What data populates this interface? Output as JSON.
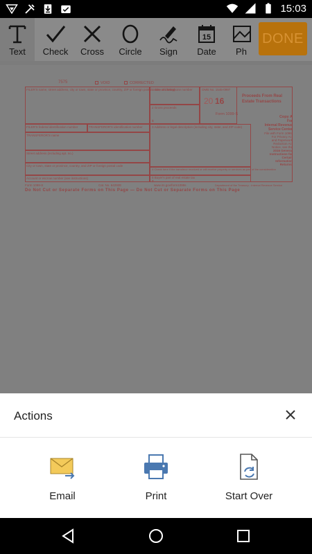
{
  "status_bar": {
    "time": "15:03",
    "icons": [
      "signal-outline-icon",
      "tools-icon",
      "download-icon",
      "image-check-icon",
      "wifi-icon",
      "cell-signal-icon",
      "battery-icon"
    ]
  },
  "toolbar": {
    "tools": [
      {
        "label": "Text",
        "icon": "text-T-icon",
        "active": true
      },
      {
        "label": "Check",
        "icon": "checkmark-icon"
      },
      {
        "label": "Cross",
        "icon": "cross-x-icon"
      },
      {
        "label": "Circle",
        "icon": "circle-icon"
      },
      {
        "label": "Sign",
        "icon": "pen-sign-icon"
      },
      {
        "label": "Date",
        "icon": "calendar-icon",
        "calendar_day": "15"
      },
      {
        "label": "Ph",
        "icon": "photo-icon"
      }
    ],
    "done_label": "DONE"
  },
  "document": {
    "form_code": "7575",
    "void_label": "VOID",
    "corrected_label": "CORRECTED",
    "filer_name_label": "FILER'S name, street address, city or town, state or province, country, ZIP or foreign postal code, and telephone number",
    "date_closing_label": "1 Date of closing",
    "omb_label": "OMB No. 1545-0997",
    "year_prefix": "20",
    "year_suffix": "16",
    "form_name": "Form 1099-S",
    "title_line1": "Proceeds From Real",
    "title_line2": "Estate Transactions",
    "gross_proceeds_label": "2 Gross proceeds",
    "dollar_sign": "$",
    "filer_tin_label": "FILER'S federal identification number",
    "transferor_tin_label": "TRANSFEROR'S identification number",
    "address_label": "3 Address or legal description (including city, state, and ZIP code)",
    "transferor_name_label": "TRANSFEROR'S name",
    "street_label": "Street address (including apt. no.)",
    "city_label": "City or town, state or province, country, and ZIP or foreign postal code",
    "account_label": "Account or escrow number (see instructions)",
    "check_here_label": "4 Check here if the transferor received or will receive property or services as part of the consideration",
    "buyer_tax_label": "5 Buyer's part of real estate tax",
    "copy_a_lines": [
      "Copy A",
      "For",
      "Internal Revenue",
      "Service Center",
      "File with Form 1096.",
      "For Privacy Act",
      "and Paperwork",
      "Reduction Act",
      "Notice, see the",
      "2016 General",
      "Instructions for",
      "Certain",
      "Information",
      "Returns."
    ],
    "footer_form": "Form 1099-S",
    "footer_cat": "Cat. No. 64292E",
    "footer_url": "www.irs.gov/form1099s",
    "footer_dept": "Department of the Treasury - Internal Revenue Service",
    "do_not_cut": "Do Not Cut or Separate Forms on This Page — Do Not Cut or Separate Forms on This Page"
  },
  "actions_sheet": {
    "title": "Actions",
    "items": [
      {
        "label": "Email",
        "icon": "email-send-icon"
      },
      {
        "label": "Print",
        "icon": "printer-icon"
      },
      {
        "label": "Start Over",
        "icon": "document-refresh-icon"
      }
    ]
  },
  "nav_bar": {
    "icons": [
      "back-triangle-icon",
      "home-circle-icon",
      "recents-square-icon"
    ]
  },
  "colors": {
    "toolbar_bg": "#8a8a8a",
    "done_bg": "#b8720c",
    "doc_overlay": "#808080",
    "form_red": "#944646",
    "sheet_bg": "#ffffff"
  }
}
